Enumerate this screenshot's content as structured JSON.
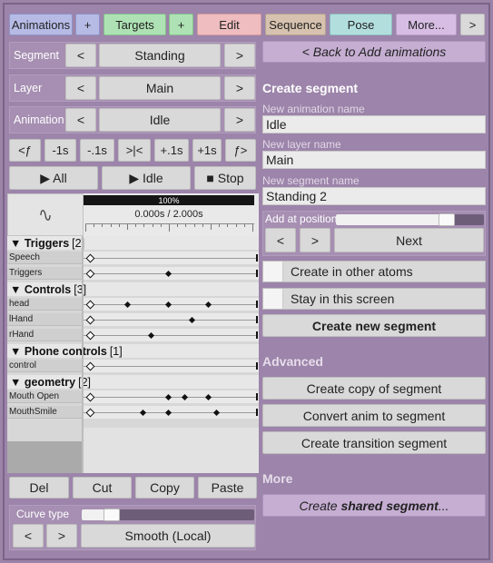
{
  "tabs": {
    "animations": "Animations",
    "add1": "+",
    "targets": "Targets",
    "add2": "+",
    "edit": "Edit",
    "sequence": "Sequence",
    "pose": "Pose",
    "more": "More...",
    "next": ">"
  },
  "selectors": [
    {
      "label": "Segment",
      "value": "Standing",
      "prev": "<",
      "next": ">"
    },
    {
      "label": "Layer",
      "value": "Main",
      "prev": "<",
      "next": ">"
    },
    {
      "label": "Animation",
      "value": "Idle",
      "prev": "<",
      "next": ">"
    }
  ],
  "transport": {
    "prev_frame": "<ƒ",
    "minus1": "-1s",
    "minus_tenth": "-.1s",
    "snap": ">|<",
    "plus_tenth": "+.1s",
    "plus1": "+1s",
    "next_frame": "ƒ>",
    "play_all": "▶ All",
    "play_idle": "▶ Idle",
    "stop": "■ Stop"
  },
  "timeline": {
    "zoom": "100%",
    "zoom_fraction": 1.0,
    "time": "0.000s / 2.000s",
    "groups": [
      {
        "name": "▼ Triggers",
        "count": "[2]",
        "tracks": [
          "Speech",
          "Triggers"
        ]
      },
      {
        "name": "▼ Controls",
        "count": "[3]",
        "tracks": [
          "head",
          "lHand",
          "rHand"
        ]
      },
      {
        "name": "▼ Phone controls",
        "count": "[1]",
        "tracks": [
          "control"
        ]
      },
      {
        "name": "▼ geometry",
        "count": "[2]",
        "tracks": [
          "Mouth Open",
          "MouthSmile"
        ]
      }
    ]
  },
  "edit_actions": {
    "del": "Del",
    "cut": "Cut",
    "copy": "Copy",
    "paste": "Paste"
  },
  "curve": {
    "label": "Curve type",
    "prev": "<",
    "next": ">",
    "value": "Smooth (Local)"
  },
  "right": {
    "back": "< Back to Add animations",
    "create_title": "Create segment",
    "anim_name_label": "New animation name",
    "anim_name": "Idle",
    "layer_name_label": "New layer name",
    "layer_name": "Main",
    "segment_name_label": "New segment name",
    "segment_name": "Standing 2",
    "add_at_label": "Add at position",
    "add_at_fraction": 0.78,
    "pos_prev": "<",
    "pos_next": ">",
    "pos_value": "Next",
    "toggle_other_atoms": "Create in other atoms",
    "toggle_stay": "Stay in this screen",
    "create_new": "Create new segment",
    "advanced_title": "Advanced",
    "copy_segment": "Create copy of segment",
    "convert_anim": "Convert anim to segment",
    "create_transition": "Create transition segment",
    "more_title": "More",
    "shared_prefix": "Create ",
    "shared_bold": "shared segment",
    "shared_suffix": "..."
  }
}
